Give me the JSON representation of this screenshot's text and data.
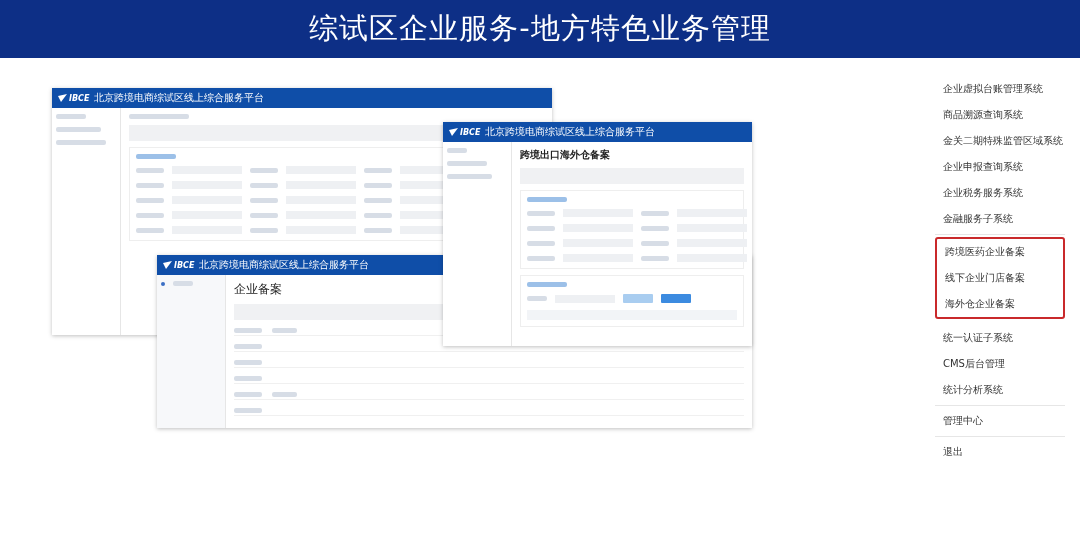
{
  "title": "综试区企业服务-地方特色业务管理",
  "windows": [
    {
      "kind": "profile",
      "logo": "IBCE",
      "platform": "北京跨境电商综试区线上综合服务平台"
    },
    {
      "kind": "warehouse",
      "logo": "IBCE",
      "platform": "北京跨境电商综试区线上综合服务平台",
      "page_title": "跨境出口海外仓备案"
    },
    {
      "kind": "filing",
      "logo": "IBCE",
      "platform": "北京跨境电商综试区线上综合服务平台",
      "page_title": "企业备案"
    }
  ],
  "menu": {
    "groups": [
      {
        "highlighted": false,
        "items": [
          "企业虚拟台账管理系统",
          "商品溯源查询系统",
          "金关二期特殊监管区域系统",
          "企业申报查询系统",
          "企业税务服务系统",
          "金融服务子系统"
        ]
      },
      {
        "highlighted": true,
        "items": [
          "跨境医药企业备案",
          "线下企业门店备案",
          "海外仓企业备案"
        ]
      },
      {
        "highlighted": false,
        "items": [
          "统一认证子系统",
          "CMS后台管理",
          "统计分析系统"
        ]
      },
      {
        "highlighted": false,
        "items": [
          "管理中心"
        ]
      },
      {
        "highlighted": false,
        "items": [
          "退出"
        ]
      }
    ]
  }
}
